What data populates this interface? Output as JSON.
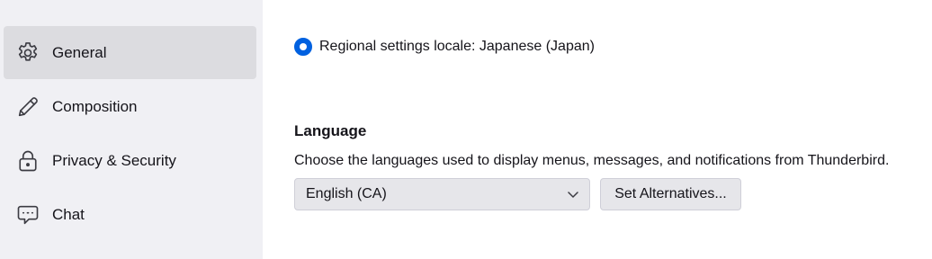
{
  "sidebar": {
    "items": [
      {
        "label": "General",
        "icon": "gear-icon",
        "selected": true
      },
      {
        "label": "Composition",
        "icon": "pencil-icon",
        "selected": false
      },
      {
        "label": "Privacy & Security",
        "icon": "lock-icon",
        "selected": false
      },
      {
        "label": "Chat",
        "icon": "chat-bubble-icon",
        "selected": false
      }
    ]
  },
  "locale": {
    "radio_label": "Regional settings locale: Japanese (Japan)",
    "selected": true
  },
  "language": {
    "title": "Language",
    "description": "Choose the languages used to display menus, messages, and notifications from Thunderbird.",
    "select_value": "English (CA)",
    "alternatives_button": "Set Alternatives..."
  },
  "colors": {
    "accent": "#0061e0",
    "sidebar_bg": "#f0f0f4",
    "selected_item_bg": "#dcdce0",
    "control_bg": "#e6e6ea"
  }
}
